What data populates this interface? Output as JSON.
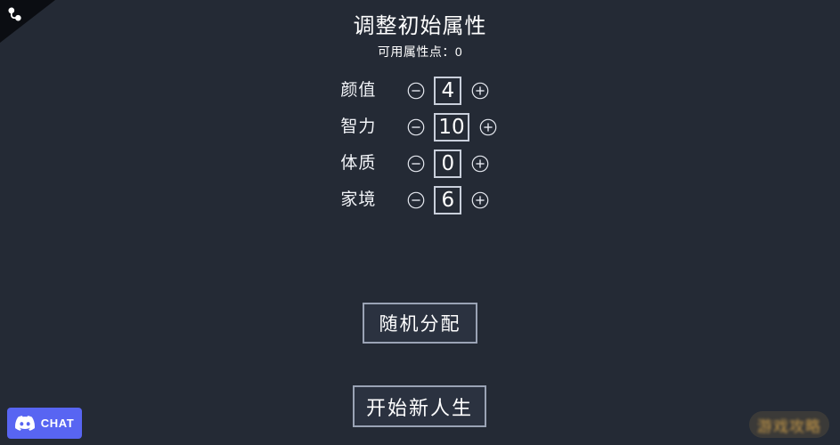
{
  "screen": {
    "background_color": "#242a35",
    "title": "调整初始属性",
    "points_label": "可用属性点：",
    "points_value": "0"
  },
  "corner": {
    "icon_name": "fork-corner-icon"
  },
  "attributes": {
    "minus_icon": "circle-minus-icon",
    "plus_icon": "circle-plus-icon",
    "rows": [
      {
        "label": "颜值",
        "value": "4"
      },
      {
        "label": "智力",
        "value": "10"
      },
      {
        "label": "体质",
        "value": "0"
      },
      {
        "label": "家境",
        "value": "6"
      }
    ]
  },
  "buttons": {
    "random_label": "随机分配",
    "start_label": "开始新人生",
    "border_color": "#9aa3b5",
    "fill_color": "#2b3240"
  },
  "discord": {
    "label": "CHAT",
    "icon_name": "discord-icon",
    "brand_color": "#5865f2"
  },
  "watermark": {
    "text": "游戏攻略",
    "color": "#d3a24a"
  }
}
